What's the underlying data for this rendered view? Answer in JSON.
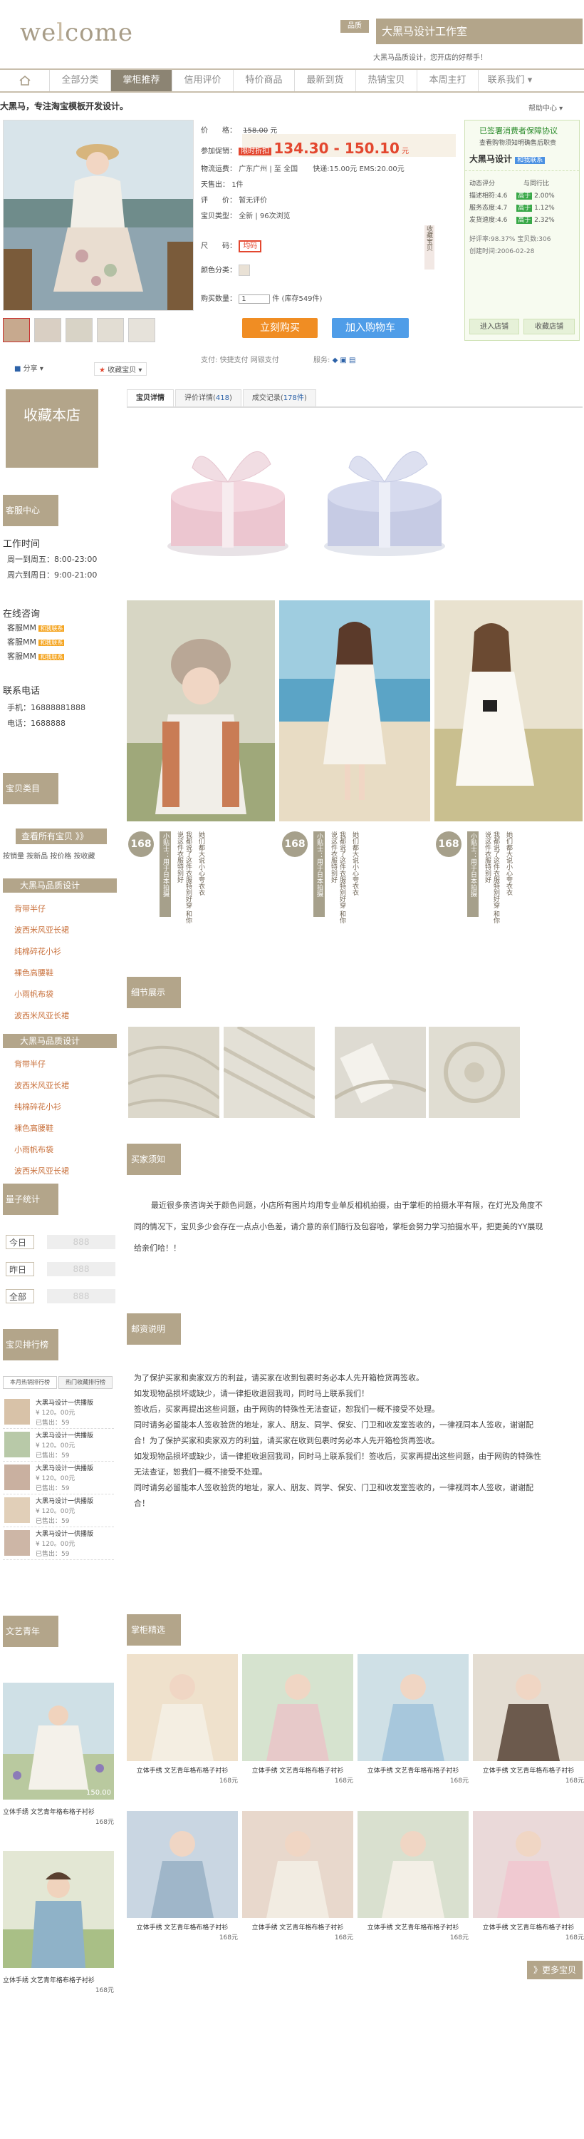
{
  "header": {
    "logo_text_1": "we",
    "logo_text_2": "l",
    "logo_text_3": "come",
    "shop_badge": "品质",
    "shop_name": "大黑马设计工作室",
    "slogan": "大黑马品质设计，您开店的好帮手！"
  },
  "nav": {
    "home_icon": "home-icon",
    "items": [
      "全部分类",
      "掌柜推荐",
      "信用评价",
      "特价商品",
      "最新到货",
      "热销宝贝",
      "本周主打"
    ],
    "active_index": 1,
    "right_label": "联系我们"
  },
  "product": {
    "headline": "大黑马，专注淘宝模板开发设计。",
    "help_link": "帮助中心",
    "price_label": "价　　格：",
    "price_old": "158.00",
    "unit": "元",
    "promo_label": "参加促销：",
    "promo_badge": "限时折扣",
    "promo_price": "134.30 - 150.10",
    "promo_unit": "元",
    "logistics_label": "物流运费：",
    "logistics_value": "广东广州 | 至 全国",
    "logistics_fees": "快递:15.00元 EMS:20.00元",
    "sold_label": "天售出：",
    "sold_value": "1件",
    "rating_label": "评　　价：",
    "rating_value": "暂无评价",
    "category_label": "宝贝类型：",
    "category_value": "全新 | 96次浏览",
    "size_label": "尺　　码：",
    "size_value": "均码",
    "color_label": "颜色分类：",
    "qty_label": "购买数量：",
    "qty_value": "1",
    "stock_text": "件 (库存549件)",
    "buy_button": "立刻购买",
    "cart_button": "加入购物车",
    "pay_label": "支付:",
    "pay_value": "快捷支付  网银支付",
    "service_label": "服务:",
    "collect_label": "收藏宝贝",
    "share_label": "分享"
  },
  "seller": {
    "guarantee": "已签署消费者保障协议",
    "guarantee_sub": "查看购物须知明确售后职责",
    "name": "大黑马设计",
    "contact": "和我联系",
    "ratings": [
      {
        "label": "描述相符:4.6",
        "delta": "2.00%"
      },
      {
        "label": "服务态度:4.7",
        "delta": "1.12%"
      },
      {
        "label": "发货速度:4.6",
        "delta": "2.32%"
      }
    ],
    "dynamic_label": "动态评分",
    "compare_label": "与同行比",
    "praise_rate": "好评率:98.37%  宝贝数:306",
    "open_date": "创建时间:2006-02-28",
    "enter_shop": "进入店铺",
    "fav_shop": "收藏店铺"
  },
  "sidebar": {
    "favorite": "收藏本店",
    "service_head": "客服中心",
    "work_time_title": "工作时间",
    "work_time_1": "周一到周五：8:00-23:00",
    "work_time_2": "周六到周日：9:00-21:00",
    "consult_title": "在线咨询",
    "consult_items": [
      "客服MM",
      "客服MM",
      "客服MM"
    ],
    "phone_title": "联系电话",
    "mobile": "手机：16888881888",
    "tel": "电话：1688888",
    "category_head": "宝贝类目",
    "view_all": "查看所有宝贝 》》",
    "sort_links": "按销量 按新品 按价格 按收藏",
    "group1": "大黑马品质设计",
    "group1_items": [
      "背带半仔",
      "波西米风亚长裙",
      "纯棉碎花小衫",
      "裸色高腰鞋",
      "小雨帆布袋",
      "波西米风亚长裙"
    ],
    "group2": "大黑马品质设计",
    "group2_items": [
      "背带半仔",
      "波西米风亚长裙",
      "纯棉碎花小衫",
      "裸色高腰鞋",
      "小雨帆布袋",
      "波西米风亚长裙"
    ],
    "stats_head": "量子统计",
    "stats": [
      {
        "label": "今日",
        "value": "888"
      },
      {
        "label": "昨日",
        "value": "888"
      },
      {
        "label": "全部",
        "value": "888"
      }
    ],
    "rank_head": "宝贝排行榜",
    "rank_tab1": "本月热销排行榜",
    "rank_tab2": "热门收藏排行榜",
    "rank_items": [
      {
        "title": "大黑马设计一供播版",
        "price": "¥ 120。00元",
        "sold": "已售出：59"
      },
      {
        "title": "大黑马设计一供播版",
        "price": "¥ 120。00元",
        "sold": "已售出：59"
      },
      {
        "title": "大黑马设计一供播版",
        "price": "¥ 120。00元",
        "sold": "已售出：59"
      },
      {
        "title": "大黑马设计一供播版",
        "price": "¥ 120。00元",
        "sold": "已售出：59"
      },
      {
        "title": "大黑马设计一供播版",
        "price": "¥ 120。00元",
        "sold": "已售出：59"
      }
    ],
    "promo_head": "文艺青年",
    "promo_items": [
      {
        "caption": "立体手绣 文艺青年格布格子衬衫",
        "price": "168元",
        "tag": "150.00"
      },
      {
        "caption": "立体手绣 文艺青年格布格子衬衫",
        "price": "168元"
      }
    ]
  },
  "content": {
    "tabs": [
      {
        "label": "宝贝详情"
      },
      {
        "label": "评价详情",
        "count": "418"
      },
      {
        "label": "成交记录",
        "count": "178件"
      }
    ],
    "model_cards": [
      {
        "price": "168",
        "vert1": "小贴士：用于日本拍摄",
        "vert2": "我都说了这件衣服特别好穿 和你说这件衣服特别好",
        "vert3": "她们都大说小心夸衣衣"
      },
      {
        "price": "168",
        "vert1": "小贴士：用于日本拍摄",
        "vert2": "我都说了这件衣服特别好穿 和你说这件衣服特别好",
        "vert3": "她们都大说小心夸衣衣"
      },
      {
        "price": "168",
        "vert1": "小贴士：用于日本拍摄",
        "vert2": "我都说了这件衣服特别好穿 和你说这件衣服特别好",
        "vert3": "她们都大说小心夸衣衣"
      }
    ],
    "detail_head": "细节展示",
    "notice_head": "买家须知",
    "notice_text": "最近很多亲咨询关于颜色问题，小店所有图片均用专业单反相机拍摄，由于掌柜的拍摄水平有限，在灯光及角度不同的情况下，宝贝多少会存在一点点小色差，请介意的亲们随行及包容哈，掌柜会努力学习拍摄水平，把更美的YY展现给亲们哈！！",
    "shipping_head": "邮资说明",
    "shipping_text": "为了保护买家和卖家双方的利益，请买家在收到包裹时务必本人先开箱检货再签收。\n如发现物品损坏或缺少，请一律拒收退回我司，同时马上联系我们！\n签收后，买家再提出这些问题，由于网购的特殊性无法查证，恕我们一概不接受不处理。\n同时请务必留能本人签收验货的地址，家人、朋友、同学、保安、门卫和收发室签收的，一律视同本人签收，谢谢配合！为了保护买家和卖家双方的利益，请买家在收到包裹时务必本人先开箱检货再签收。\n如发现物品损坏或缺少，请一律拒收退回我司，同时马上联系我们！签收后，买家再提出这些问题，由于网购的特殊性无法查证，恕我们一概不接受不处理。\n同时请务必留能本人签收验货的地址，家人、朋友、同学、保安、门卫和收发室签收的，一律视同本人签收，谢谢配合！",
    "picks_head": "掌柜精选",
    "picks": [
      {
        "caption": "立体手绣 文艺青年格布格子衬衫",
        "price": "168元"
      },
      {
        "caption": "立体手绣 文艺青年格布格子衬衫",
        "price": "168元"
      },
      {
        "caption": "立体手绣 文艺青年格布格子衬衫",
        "price": "168元"
      },
      {
        "caption": "立体手绣 文艺青年格布格子衬衫",
        "price": "168元"
      },
      {
        "caption": "立体手绣 文艺青年格布格子衬衫",
        "price": "168元"
      },
      {
        "caption": "立体手绣 文艺青年格布格子衬衫",
        "price": "168元"
      },
      {
        "caption": "立体手绣 文艺青年格布格子衬衫",
        "price": "168元"
      },
      {
        "caption": "立体手绣 文艺青年格布格子衬衫",
        "price": "168元"
      }
    ],
    "more_link": "》更多宝贝"
  },
  "colors": {
    "accent": "#b3a58a",
    "price": "#e3472f",
    "nav_active": "#8c8473"
  }
}
